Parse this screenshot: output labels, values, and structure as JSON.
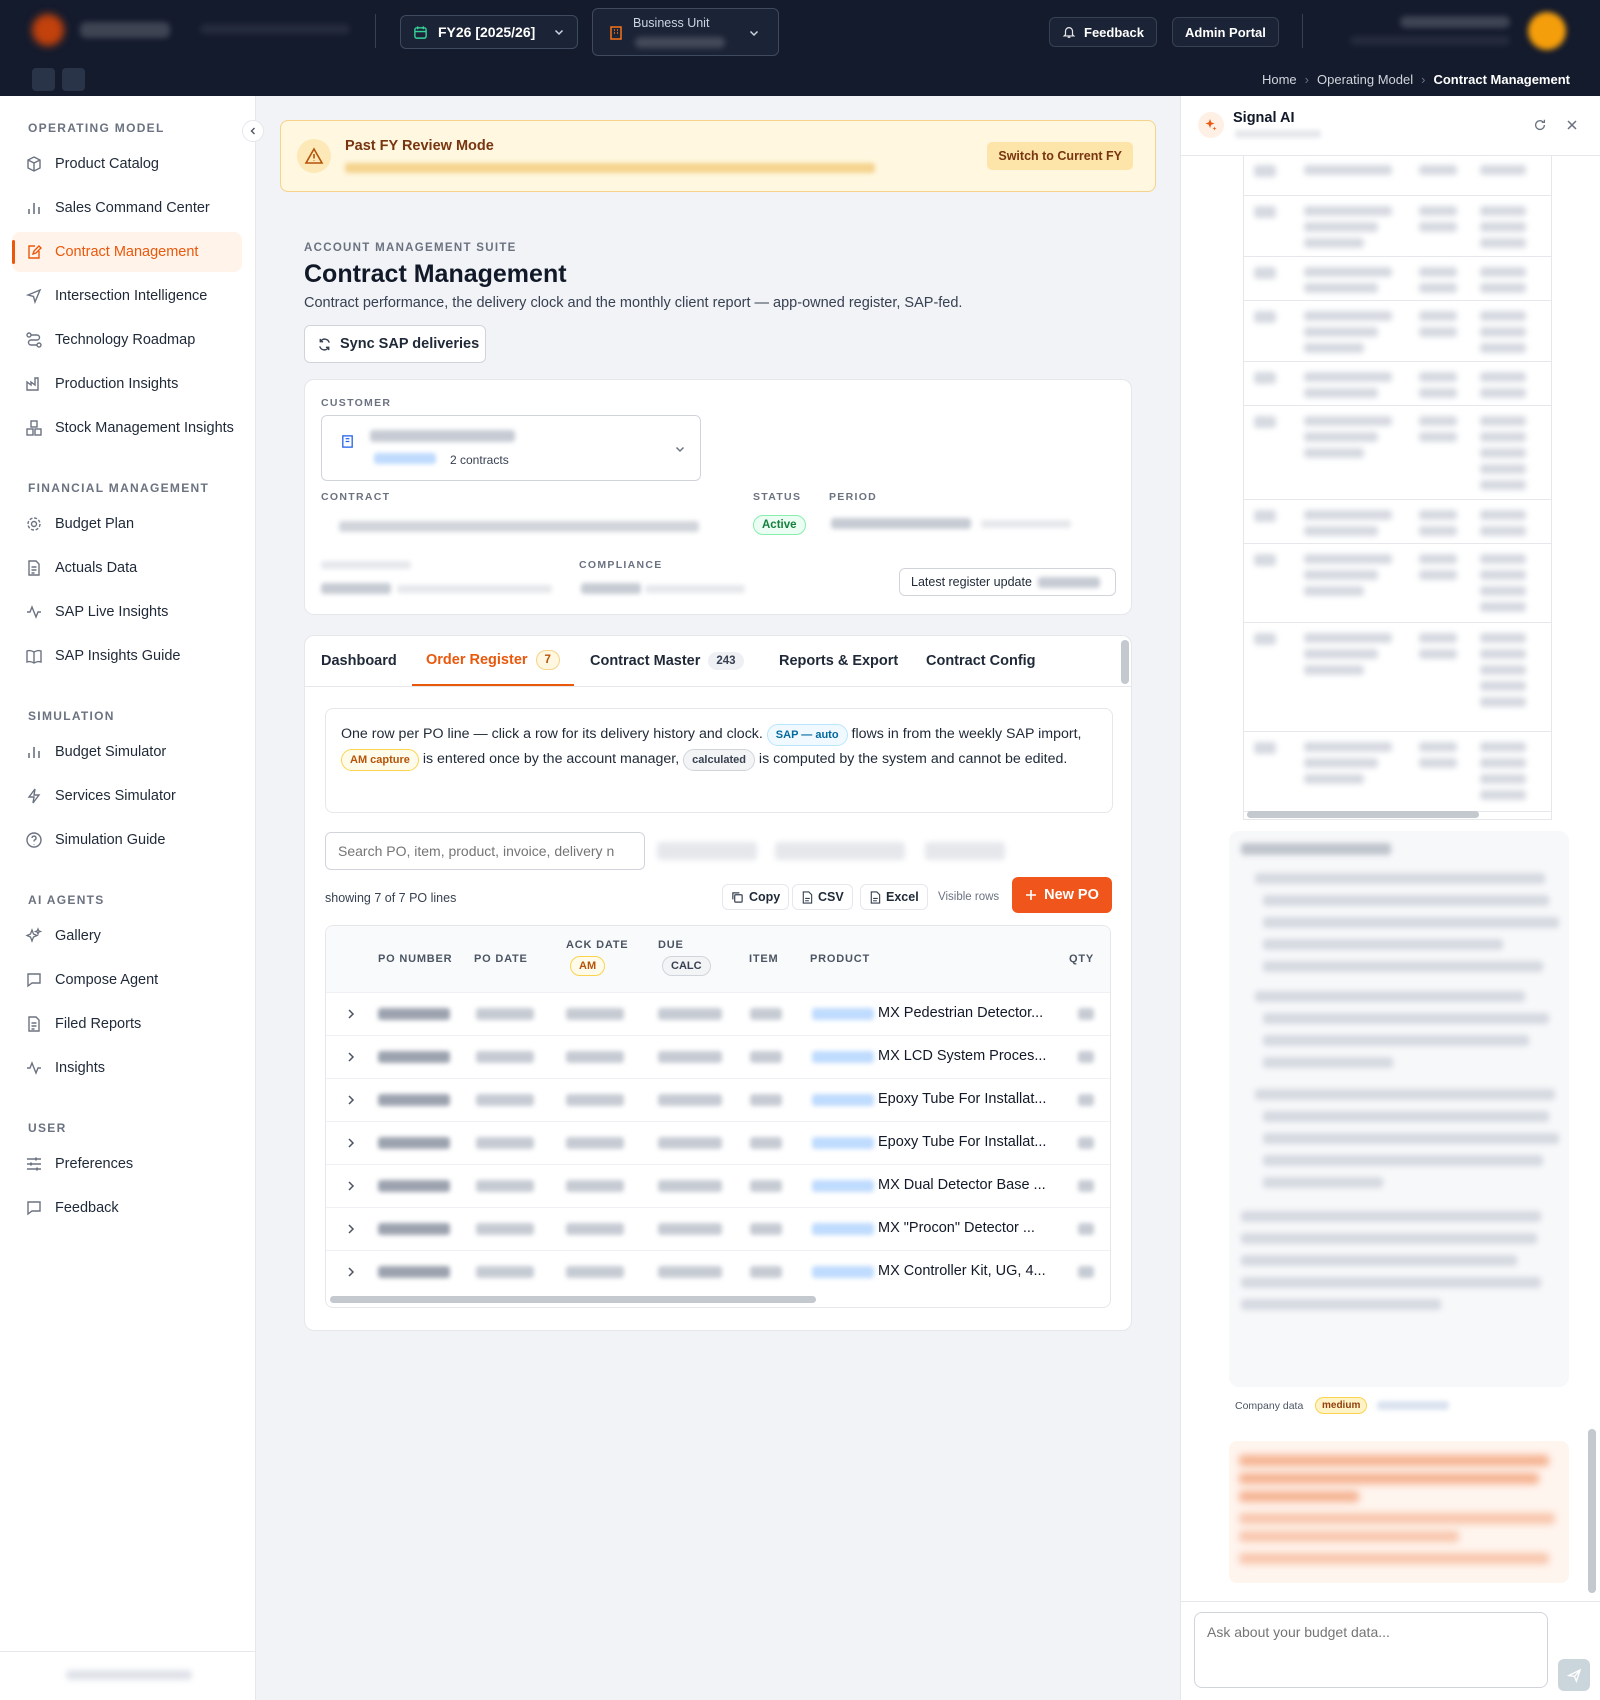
{
  "topbar": {
    "fy_label": "FY26 [2025/26]",
    "business_unit_label": "Business Unit",
    "feedback_label": "Feedback",
    "admin_label": "Admin Portal"
  },
  "breadcrumb": {
    "items": [
      "Home",
      "Operating Model",
      "Contract Management"
    ]
  },
  "sidebar": {
    "sections": [
      {
        "title": "OPERATING MODEL",
        "items": [
          "Product Catalog",
          "Sales Command Center",
          "Contract Management",
          "Intersection Intelligence",
          "Technology Roadmap",
          "Production Insights",
          "Stock Management Insights"
        ]
      },
      {
        "title": "FINANCIAL MANAGEMENT",
        "items": [
          "Budget Plan",
          "Actuals Data",
          "SAP Live Insights",
          "SAP Insights Guide"
        ]
      },
      {
        "title": "SIMULATION",
        "items": [
          "Budget Simulator",
          "Services Simulator",
          "Simulation Guide"
        ]
      },
      {
        "title": "AI AGENTS",
        "items": [
          "Gallery",
          "Compose Agent",
          "Filed Reports",
          "Insights"
        ]
      },
      {
        "title": "USER",
        "items": [
          "Preferences",
          "Feedback"
        ]
      }
    ],
    "active_item": "Contract Management"
  },
  "banner": {
    "title": "Past FY Review Mode",
    "button": "Switch to Current FY"
  },
  "header": {
    "eyebrow": "ACCOUNT MANAGEMENT SUITE",
    "title": "Contract Management",
    "description": "Contract performance, the delivery clock and the monthly client report — app-owned register, SAP-fed.",
    "sync_button": "Sync SAP deliveries"
  },
  "contract_card": {
    "customer_label": "CUSTOMER",
    "contracts_count": "2 contracts",
    "contract_label": "CONTRACT",
    "status_label": "STATUS",
    "status_value": "Active",
    "period_label": "PERIOD",
    "compliance_label": "COMPLIANCE",
    "latest_update_label": "Latest register update"
  },
  "tabs": [
    {
      "label": "Dashboard",
      "count": ""
    },
    {
      "label": "Order Register",
      "count": "7"
    },
    {
      "label": "Contract Master",
      "count": "243"
    },
    {
      "label": "Reports & Export",
      "count": ""
    },
    {
      "label": "Contract Config",
      "count": ""
    }
  ],
  "info": {
    "text1": "One row per PO line — click a row for its delivery history and clock.",
    "pill_sap": "SAP — auto",
    "text2": "flows in from the weekly SAP import,",
    "pill_am": "AM capture",
    "text3": "is entered once by the account manager,",
    "pill_calc": "calculated",
    "text4": "is computed by the system and cannot be edited."
  },
  "search": {
    "placeholder": "Search PO, item, product, invoice, delivery n"
  },
  "toolbar": {
    "showing": "showing 7 of 7 PO lines",
    "copy": "Copy",
    "csv": "CSV",
    "excel": "Excel",
    "visible_rows": "Visible rows",
    "new_po": "New PO"
  },
  "table": {
    "columns": {
      "po_number": "PO NUMBER",
      "po_date": "PO DATE",
      "ack_date": "ACK DATE",
      "ack_tag": "AM",
      "due": "DUE",
      "due_tag": "CALC",
      "item": "ITEM",
      "product": "PRODUCT",
      "qty": "QTY"
    },
    "rows": [
      {
        "product": "MX Pedestrian Detector..."
      },
      {
        "product": "MX LCD System Proces..."
      },
      {
        "product": "Epoxy Tube For Installat..."
      },
      {
        "product": "Epoxy Tube For Installat..."
      },
      {
        "product": "MX Dual Detector Base ..."
      },
      {
        "product": "MX \"Procon\" Detector ..."
      },
      {
        "product": "MX Controller Kit, UG, 4..."
      }
    ]
  },
  "ai_panel": {
    "title": "Signal AI",
    "company_data": "Company data",
    "confidence": "medium",
    "input_placeholder": "Ask about your budget data..."
  },
  "colors": {
    "accent": "#ea580c",
    "nav_bg": "#141b2d",
    "banner_bg": "#fff7e0"
  }
}
